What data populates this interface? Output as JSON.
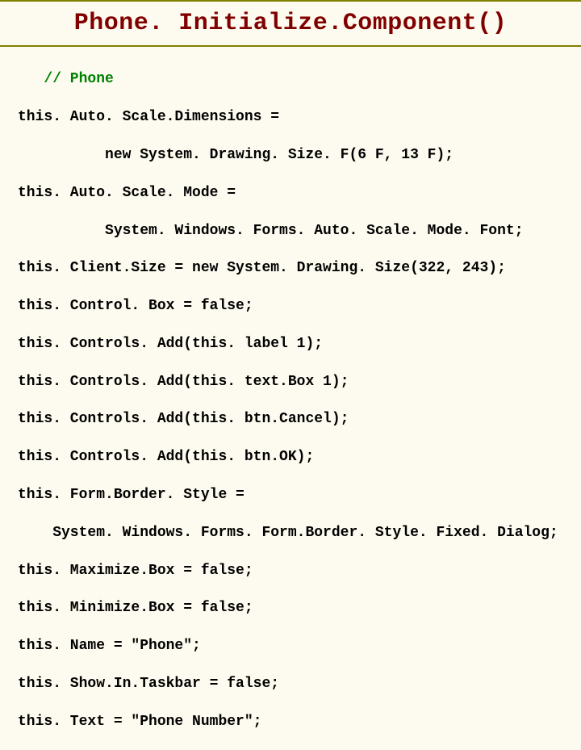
{
  "title": "Phone. Initialize.Component()",
  "code": {
    "line0": "   // Phone",
    "line1": "this. Auto. Scale.Dimensions =",
    "line2": "          new System. Drawing. Size. F(6 F, 13 F);",
    "line3": "this. Auto. Scale. Mode =",
    "line4": "          System. Windows. Forms. Auto. Scale. Mode. Font;",
    "line5": "this. Client.Size = new System. Drawing. Size(322, 243);",
    "line6": "this. Control. Box = false;",
    "line7": "this. Controls. Add(this. label 1);",
    "line8": "this. Controls. Add(this. text.Box 1);",
    "line9": "this. Controls. Add(this. btn.Cancel);",
    "line10": "this. Controls. Add(this. btn.OK);",
    "line11": "this. Form.Border. Style =",
    "line12": "    System. Windows. Forms. Form.Border. Style. Fixed. Dialog;",
    "line13": "this. Maximize.Box = false;",
    "line14": "this. Minimize.Box = false;",
    "line15": "this. Name = \"Phone\";",
    "line16": "this. Show.In.Taskbar = false;",
    "line17": "this. Text = \"Phone Number\";"
  }
}
